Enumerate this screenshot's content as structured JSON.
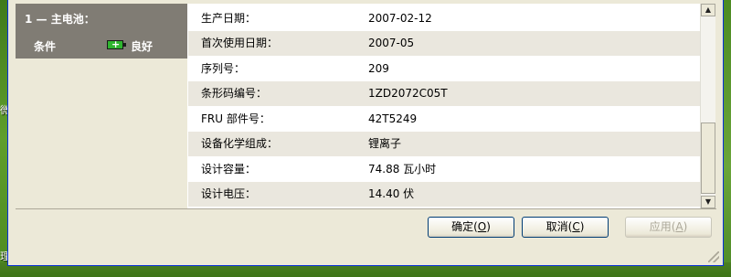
{
  "desktop": {
    "left_fragment_1": "微",
    "left_fragment_2": "理"
  },
  "battery": {
    "title": "1 — 主电池：",
    "condition_label": "条件",
    "condition_value": "良好",
    "condition_icon": "battery-icon",
    "condition_color": "#2fb52f"
  },
  "details": {
    "rows": [
      {
        "label": "生产日期：",
        "value": "2007-02-12"
      },
      {
        "label": "首次使用日期：",
        "value": "2007-05"
      },
      {
        "label": "序列号：",
        "value": "209"
      },
      {
        "label": "条形码编号：",
        "value": "1ZD2072C05T"
      },
      {
        "label": "FRU 部件号：",
        "value": "42T5249"
      },
      {
        "label": "设备化学组成：",
        "value": "锂离子"
      },
      {
        "label": "设计容量：",
        "value": "74.88 瓦小时"
      },
      {
        "label": "设计电压：",
        "value": "14.40 伏"
      }
    ]
  },
  "scrollbar": {
    "up_icon": "scroll-up-arrow-icon",
    "down_icon": "scroll-down-arrow-icon"
  },
  "buttons": {
    "ok_text": "确定",
    "ok_key": "O",
    "cancel_text": "取消",
    "cancel_key": "C",
    "apply_text": "应用",
    "apply_key": "A"
  }
}
